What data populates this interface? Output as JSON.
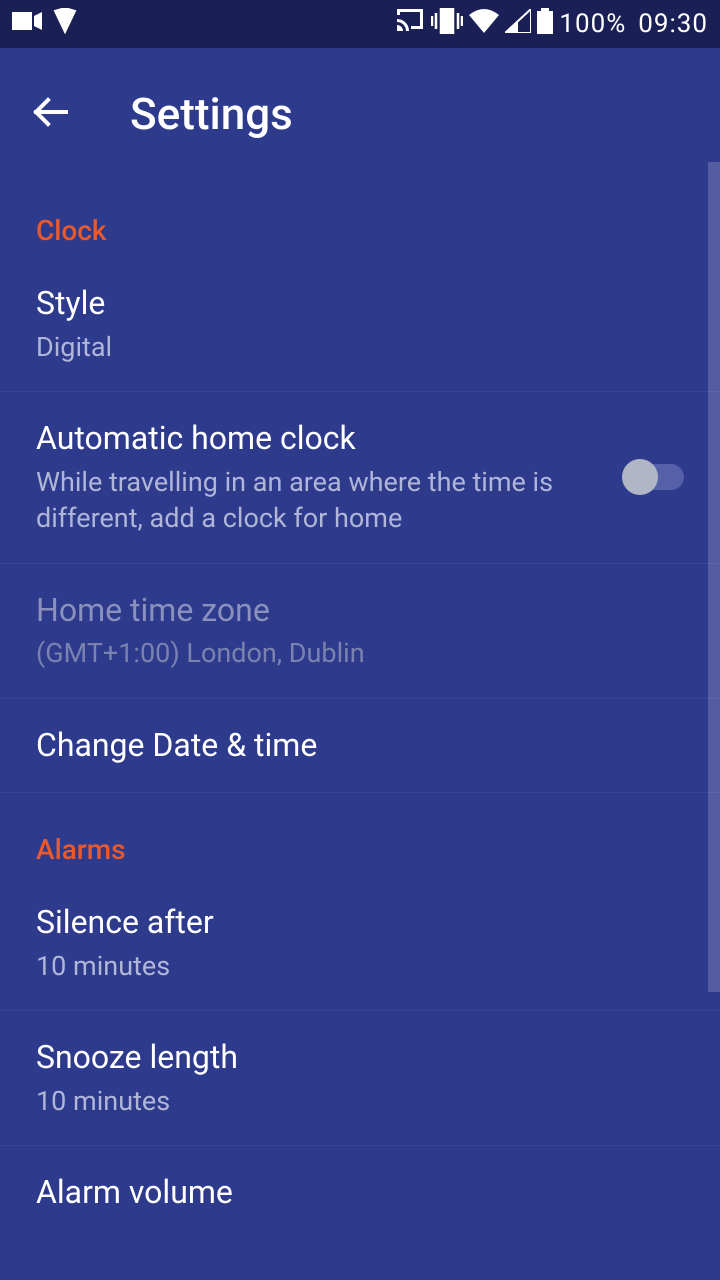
{
  "status": {
    "battery": "100%",
    "time": "09:30"
  },
  "header": {
    "title": "Settings"
  },
  "sections": {
    "clock": {
      "header": "Clock",
      "style": {
        "title": "Style",
        "value": "Digital"
      },
      "autohome": {
        "title": "Automatic home clock",
        "value": "While travelling in an area where the time is different, add a clock for home"
      },
      "hometz": {
        "title": "Home time zone",
        "value": "(GMT+1:00) London, Dublin"
      },
      "changedate": {
        "title": "Change Date & time"
      }
    },
    "alarms": {
      "header": "Alarms",
      "silence": {
        "title": "Silence after",
        "value": "10 minutes"
      },
      "snooze": {
        "title": "Snooze length",
        "value": "10 minutes"
      },
      "volume": {
        "title": "Alarm volume"
      }
    }
  }
}
